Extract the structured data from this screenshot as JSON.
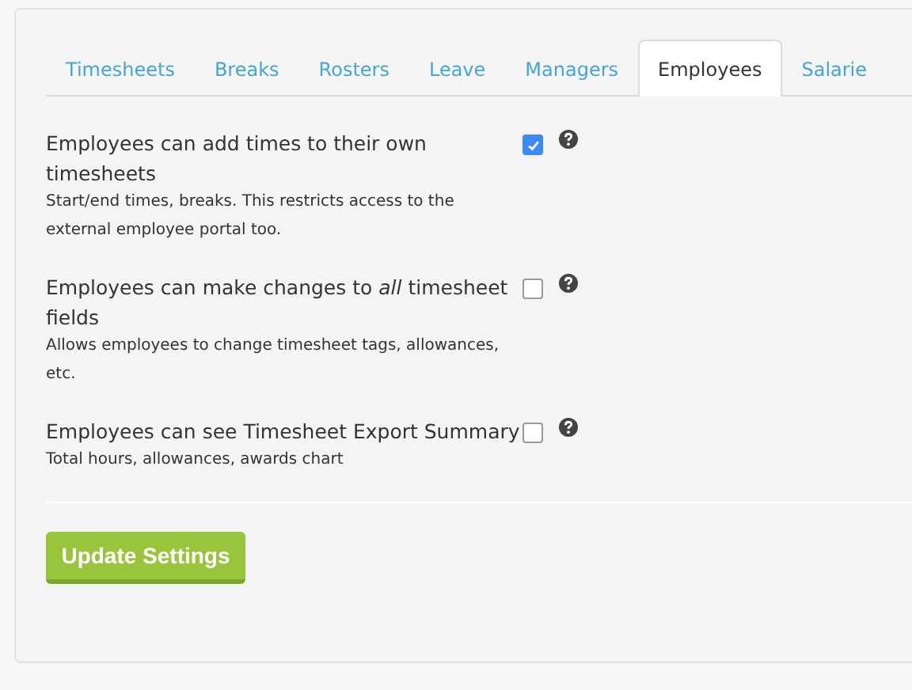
{
  "tabs": [
    {
      "label": "Timesheets",
      "selected": false
    },
    {
      "label": "Breaks",
      "selected": false
    },
    {
      "label": "Rosters",
      "selected": false
    },
    {
      "label": "Leave",
      "selected": false
    },
    {
      "label": "Managers",
      "selected": false
    },
    {
      "label": "Employees",
      "selected": true
    },
    {
      "label": "Salarie",
      "selected": false
    }
  ],
  "settings": [
    {
      "title": "Employees can add times to their own timesheets",
      "description": "Start/end times, breaks. This restricts access to the external employee portal too.",
      "checked": true
    },
    {
      "title": "Employees can make changes to *all* timesheet fields",
      "description": "Allows employees to change timesheet tags, allowances, etc.",
      "checked": false
    },
    {
      "title": "Employees can see Timesheet Export Summary",
      "description": "Total hours, allowances, awards chart",
      "checked": false
    }
  ],
  "submit_button": "Update Settings"
}
